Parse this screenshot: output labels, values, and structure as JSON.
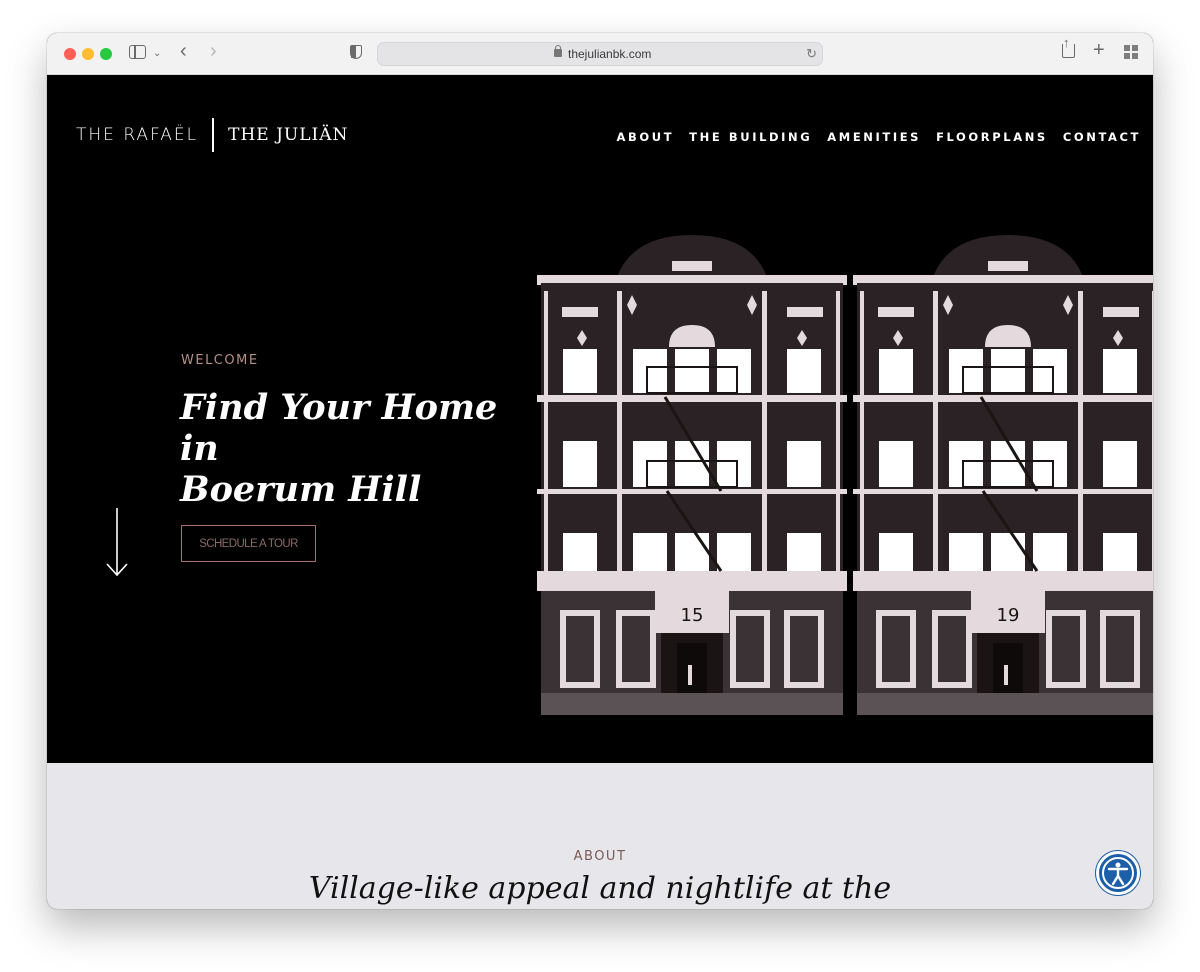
{
  "browser": {
    "url": "thejulianbk.com"
  },
  "site": {
    "logo_primary": "THE RAFAËL",
    "logo_secondary": "THE JULIÄN",
    "nav": [
      "ABOUT",
      "THE BUILDING",
      "AMENITIES",
      "FLOORPLANS",
      "CONTACT"
    ]
  },
  "hero": {
    "eyebrow": "WELCOME",
    "headline_line1": "Find Your Home in",
    "headline_line2": "Boerum Hill",
    "cta_label": "SCHEDULE A TOUR",
    "building_numbers": [
      "15",
      "19"
    ]
  },
  "about": {
    "eyebrow": "ABOUT",
    "title": "Village-like appeal and nightlife at the"
  },
  "colors": {
    "accent": "#b68f87",
    "building_dark": "#2a2224",
    "building_light": "#e4dadd"
  },
  "icons": {
    "accessibility": "accessibility-icon",
    "scroll": "arrow-down-icon"
  }
}
